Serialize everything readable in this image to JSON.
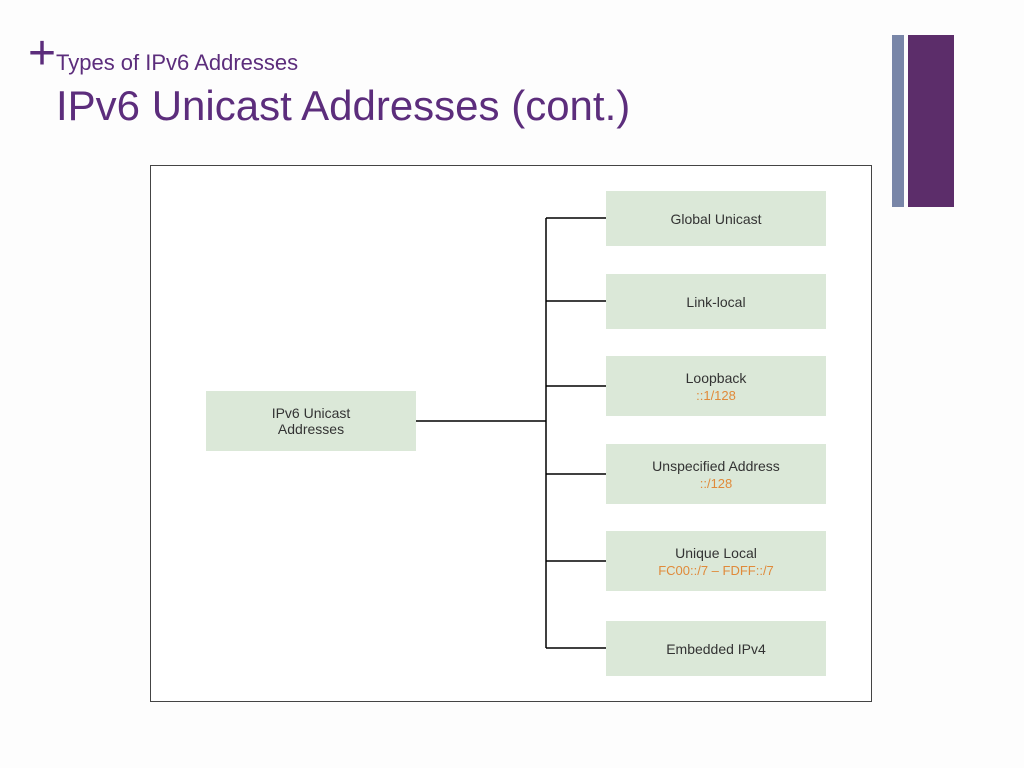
{
  "plus": "+",
  "breadcrumb": "Types of IPv6 Addresses",
  "title": "IPv6 Unicast Addresses (cont.)",
  "root": "IPv6 Unicast\nAddresses",
  "children": [
    {
      "label": "Global Unicast",
      "sub": ""
    },
    {
      "label": "Link-local",
      "sub": ""
    },
    {
      "label": "Loopback",
      "sub": "::1/128"
    },
    {
      "label": "Unspecified Address",
      "sub": "::/128"
    },
    {
      "label": "Unique Local",
      "sub": "FC00::/7 – FDFF::/7"
    },
    {
      "label": "Embedded IPv4",
      "sub": ""
    }
  ]
}
